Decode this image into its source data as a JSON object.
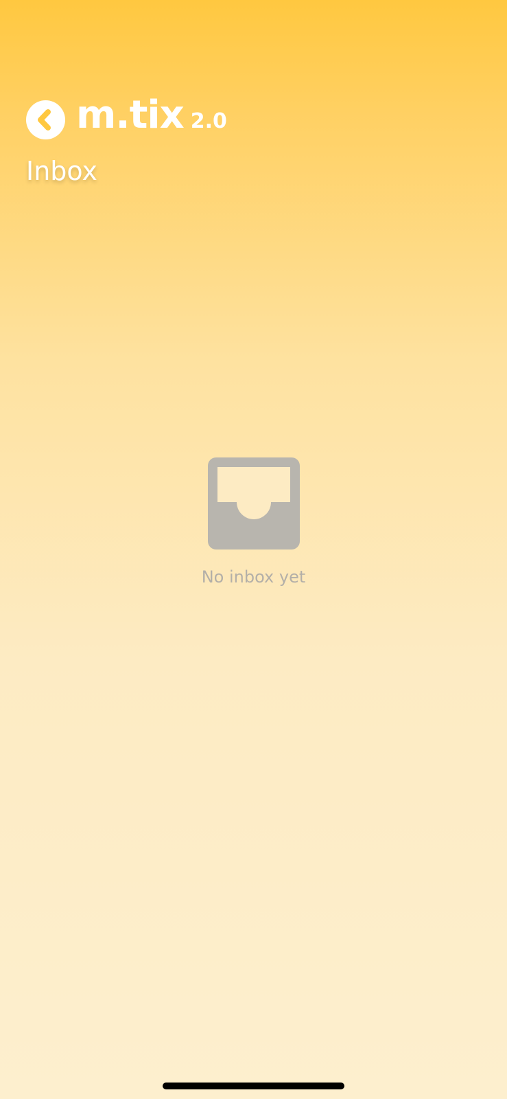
{
  "header": {
    "back_icon": "chevron-left-icon",
    "logo_text": "m.tix",
    "logo_version": "2.0",
    "title": "Inbox"
  },
  "empty_state": {
    "icon": "inbox-tray-icon",
    "message": "No inbox yet"
  },
  "colors": {
    "gradient_top": "#ffc840",
    "gradient_bottom": "#fdefce",
    "icon_gray": "#b8b5ae",
    "text_gray": "#b3afa8",
    "white": "#ffffff"
  }
}
